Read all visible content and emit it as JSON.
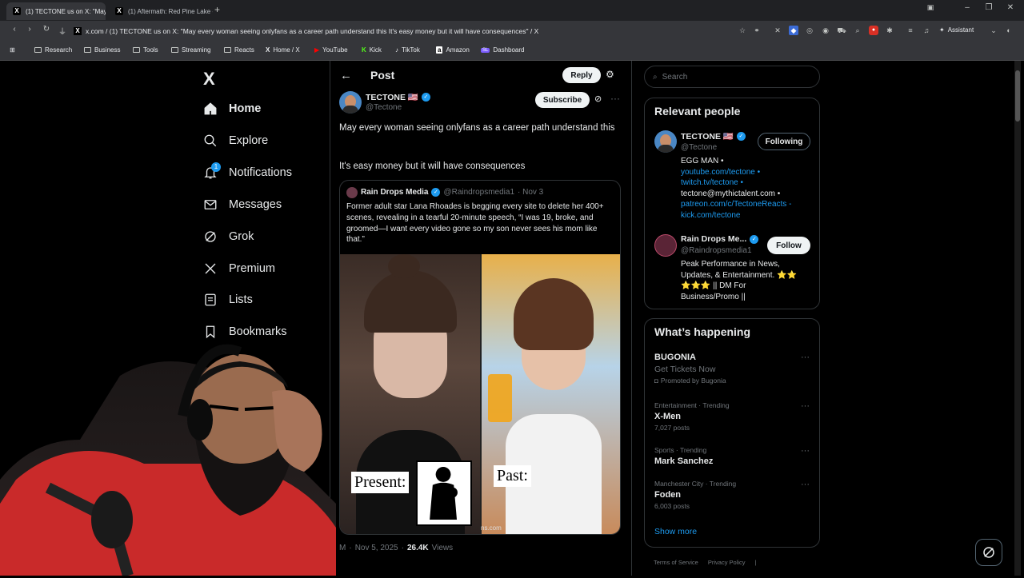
{
  "browser": {
    "tabs": [
      {
        "label": "(1) TECTONE us on X: \"May e"
      },
      {
        "label": "(1) Aftermath: Red Pine Lake -"
      }
    ],
    "new_tab": "+",
    "url": "x.com / (1) TECTONE us on X: \"May every woman seeing onlyfans as a career path understand this It's easy money but it will have consequences\" / X",
    "assistant_label": "Assistant",
    "bookmarks": [
      "Research",
      "Business",
      "Tools",
      "Streaming",
      "Reacts",
      "Home / X",
      "YouTube",
      "Kick",
      "TikTok",
      "Amazon",
      "Dashboard"
    ]
  },
  "nav": {
    "logo": "X",
    "items": [
      {
        "label": "Home",
        "icon": "home-icon"
      },
      {
        "label": "Explore",
        "icon": "search-icon"
      },
      {
        "label": "Notifications",
        "icon": "bell-icon",
        "badge": "1"
      },
      {
        "label": "Messages",
        "icon": "mail-icon"
      },
      {
        "label": "Grok",
        "icon": "grok-icon"
      },
      {
        "label": "Premium",
        "icon": "x-icon"
      },
      {
        "label": "Lists",
        "icon": "list-icon"
      },
      {
        "label": "Bookmarks",
        "icon": "bookmark-icon"
      }
    ]
  },
  "post": {
    "header_title": "Post",
    "reply_label": "Reply",
    "author_name": "TECTONE 🇺🇸",
    "author_handle": "@Tectone",
    "subscribe_label": "Subscribe",
    "text_line1": "May every woman seeing onlyfans as a career path understand this",
    "text_line2": "It's easy money but it will have consequences",
    "quote": {
      "author_name": "Rain Drops Media",
      "author_handle": "@Raindropsmedia1",
      "date": "· Nov 3",
      "text": "Former adult star Lana Rhoades is begging every site to delete her 400+ scenes, revealing in a tearful 20-minute speech, “I was 19, broke, and groomed—I want every video gone so my son never sees his mom like that.”",
      "img_label_present": "Present:",
      "img_label_past": "Past:",
      "img_watermark": "ns.com"
    },
    "meta_time": "M",
    "meta_date": "Nov 5, 2025",
    "meta_views_count": "26.4K",
    "meta_views_label": "Views"
  },
  "right": {
    "search_placeholder": "Search",
    "relevant_title": "Relevant people",
    "people": [
      {
        "name": "TECTONE 🇺🇸",
        "handle": "@Tectone",
        "button": "Following",
        "bio_lines": [
          "EGG MAN •",
          "youtube.com/tectone •",
          "twitch.tv/tectone •",
          "tectone@mythictalent.com •",
          "patreon.com/c/TectoneReacts -",
          "kick.com/tectone"
        ]
      },
      {
        "name": "Rain Drops Me...",
        "handle": "@Raindropsmedia1",
        "button": "Follow",
        "bio_lines": [
          "Peak Performance in News,",
          "Updates, & Entertainment. ⭐⭐",
          "⭐⭐⭐ || DM For",
          "Business/Promo ||"
        ]
      }
    ],
    "happening_title": "What’s happening",
    "trends": [
      {
        "context": "",
        "title": "BUGONIA",
        "sub": "Get Tickets Now",
        "promo": "Promoted by Bugonia"
      },
      {
        "context": "Entertainment · Trending",
        "title": "X-Men",
        "sub": "7,027 posts",
        "promo": ""
      },
      {
        "context": "Sports · Trending",
        "title": "Mark Sanchez",
        "sub": "",
        "promo": ""
      },
      {
        "context": "Manchester City · Trending",
        "title": "Foden",
        "sub": "6,003 posts",
        "promo": ""
      }
    ],
    "show_more": "Show more",
    "footer": [
      "Terms of Service",
      "Privacy Policy",
      "|"
    ]
  },
  "colors": {
    "accent": "#1d9bf0",
    "link": "#1d9bf0",
    "bg": "#000000",
    "border": "#2f3336"
  }
}
